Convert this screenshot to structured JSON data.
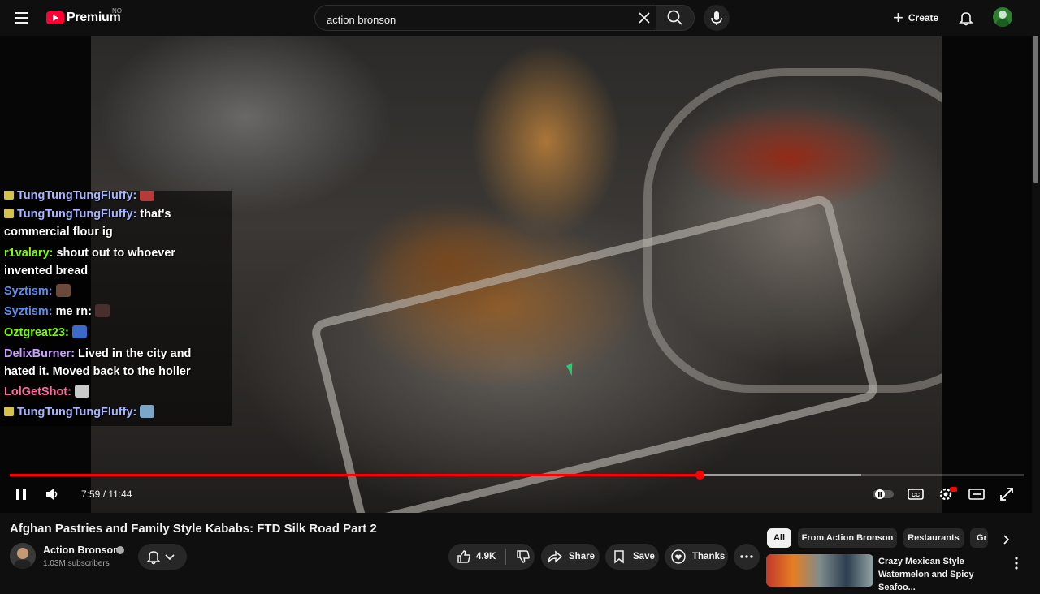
{
  "header": {
    "logo_text": "Premium",
    "country_code": "NO",
    "search_value": "action bronson",
    "create_label": "Create"
  },
  "chat": [
    {
      "user": "TungTungTungFluffy:",
      "text": "",
      "user_color": "#a5b4fc",
      "badge": true
    },
    {
      "user": "TungTungTungFluffy:",
      "text": "that's",
      "user_color": "#a5b4fc",
      "badge": true
    },
    {
      "user": "",
      "text": "commercial flour ig",
      "user_color": "#ffffff",
      "badge": false
    },
    {
      "user": "r1valary:",
      "text": "shout out to whoever",
      "user_color": "#7CFC00",
      "badge": false
    },
    {
      "user": "",
      "text": "invented bread",
      "user_color": "#ffffff",
      "badge": false
    },
    {
      "user": "Syztism:",
      "text": "",
      "user_color": "#5b8def",
      "badge": false
    },
    {
      "user": "Syztism:",
      "text": "me rn:",
      "user_color": "#5b8def",
      "badge": false
    },
    {
      "user": "Oztgreat23:",
      "text": "",
      "user_color": "#7CFC00",
      "badge": false
    },
    {
      "user": "DelixBurner:",
      "text": "Lived in the city and",
      "user_color": "#c9a0ff",
      "badge": false
    },
    {
      "user": "",
      "text": "hated it. Moved back to the holler",
      "user_color": "#ffffff",
      "badge": false
    },
    {
      "user": "LolGetShot:",
      "text": "",
      "user_color": "#ff6b9d",
      "badge": false
    },
    {
      "user": "TungTungTungFluffy:",
      "text": "",
      "user_color": "#a5b4fc",
      "badge": true
    }
  ],
  "player": {
    "time_display": "7:59 / 11:44",
    "progress_fraction": 0.68,
    "buffer_fraction": 0.84
  },
  "video": {
    "title": "Afghan Pastries and Family Style Kababs: FTD Silk Road Part 2",
    "channel_name": "Action Bronson",
    "subscribers": "1.03M subscribers",
    "likes": "4.9K",
    "share_label": "Share",
    "save_label": "Save",
    "thanks_label": "Thanks"
  },
  "chips": [
    {
      "label": "All",
      "active": true
    },
    {
      "label": "From Action Bronson",
      "active": false
    },
    {
      "label": "Restaurants",
      "active": false
    },
    {
      "label": "Gr",
      "active": false
    }
  ],
  "recommendation": {
    "title": "Crazy Mexican Style Watermelon and Spicy Seafoo..."
  },
  "colors": {
    "brand_red": "#ff0033",
    "progress_red": "#ff0000",
    "background": "#0f0f0f"
  }
}
